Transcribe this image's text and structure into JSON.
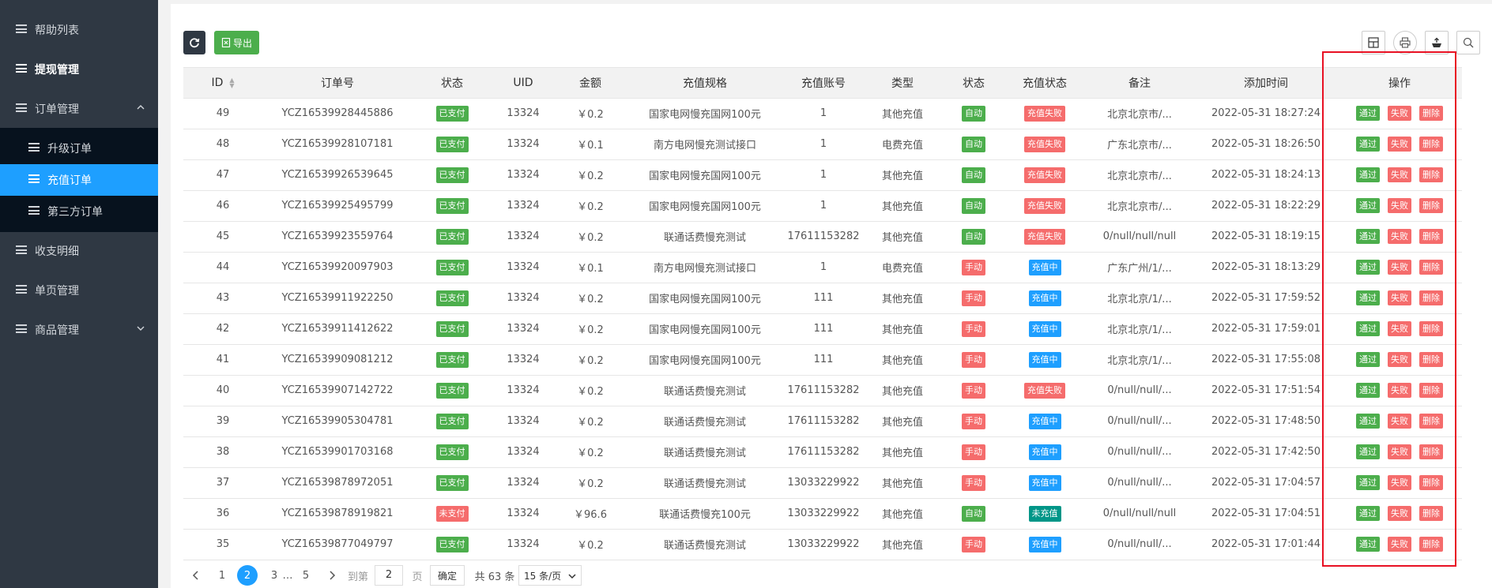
{
  "sidebar": {
    "items": [
      {
        "label": "帮助列表",
        "icon": "list-icon"
      },
      {
        "label": "提现管理",
        "icon": "list-icon"
      },
      {
        "label": "订单管理",
        "icon": "list-icon"
      },
      {
        "label": "收支明细",
        "icon": "list-icon"
      },
      {
        "label": "单页管理",
        "icon": "list-icon"
      },
      {
        "label": "商品管理",
        "icon": "list-icon"
      }
    ],
    "sub_items": [
      {
        "label": "升级订单"
      },
      {
        "label": "充值订单"
      },
      {
        "label": "第三方订单"
      }
    ]
  },
  "toolbar": {
    "refresh_icon": "refresh-icon",
    "export_label": "导出",
    "tools": [
      "columns-icon",
      "print-icon",
      "export-icon",
      "search-icon"
    ]
  },
  "table": {
    "headers": [
      "ID",
      "订单号",
      "状态",
      "UID",
      "金额",
      "充值规格",
      "充值账号",
      "类型",
      "状态",
      "充值状态",
      "备注",
      "添加时间",
      "操作"
    ],
    "action_labels": {
      "pass": "通过",
      "fail": "失败",
      "delete": "删除"
    },
    "rows": [
      {
        "id": "49",
        "order": "YCZ16539928445886",
        "pay": "已支付",
        "uid": "13324",
        "amount": "￥0.2",
        "spec": "国家电网慢充国网100元",
        "account": "1",
        "type": "其他充值",
        "mode": "自动",
        "charge": "充值失败",
        "note": "北京北京市/...",
        "time": "2022-05-31 18:27:24"
      },
      {
        "id": "48",
        "order": "YCZ16539928107181",
        "pay": "已支付",
        "uid": "13324",
        "amount": "￥0.1",
        "spec": "南方电网慢充测试接口",
        "account": "1",
        "type": "电费充值",
        "mode": "自动",
        "charge": "充值失败",
        "note": "广东北京市/...",
        "time": "2022-05-31 18:26:50"
      },
      {
        "id": "47",
        "order": "YCZ16539926539645",
        "pay": "已支付",
        "uid": "13324",
        "amount": "￥0.2",
        "spec": "国家电网慢充国网100元",
        "account": "1",
        "type": "其他充值",
        "mode": "自动",
        "charge": "充值失败",
        "note": "北京北京市/...",
        "time": "2022-05-31 18:24:13"
      },
      {
        "id": "46",
        "order": "YCZ16539925495799",
        "pay": "已支付",
        "uid": "13324",
        "amount": "￥0.2",
        "spec": "国家电网慢充国网100元",
        "account": "1",
        "type": "其他充值",
        "mode": "自动",
        "charge": "充值失败",
        "note": "北京北京市/...",
        "time": "2022-05-31 18:22:29"
      },
      {
        "id": "45",
        "order": "YCZ16539923559764",
        "pay": "已支付",
        "uid": "13324",
        "amount": "￥0.2",
        "spec": "联通话费慢充测试",
        "account": "17611153282",
        "type": "其他充值",
        "mode": "自动",
        "charge": "充值失败",
        "note": "0/null/null/null",
        "time": "2022-05-31 18:19:15"
      },
      {
        "id": "44",
        "order": "YCZ16539920097903",
        "pay": "已支付",
        "uid": "13324",
        "amount": "￥0.1",
        "spec": "南方电网慢充测试接口",
        "account": "1",
        "type": "电费充值",
        "mode": "手动",
        "charge": "充值中",
        "note": "广东广州/1/...",
        "time": "2022-05-31 18:13:29"
      },
      {
        "id": "43",
        "order": "YCZ16539911922250",
        "pay": "已支付",
        "uid": "13324",
        "amount": "￥0.2",
        "spec": "国家电网慢充国网100元",
        "account": "111",
        "type": "其他充值",
        "mode": "手动",
        "charge": "充值中",
        "note": "北京北京/1/...",
        "time": "2022-05-31 17:59:52"
      },
      {
        "id": "42",
        "order": "YCZ16539911412622",
        "pay": "已支付",
        "uid": "13324",
        "amount": "￥0.2",
        "spec": "国家电网慢充国网100元",
        "account": "111",
        "type": "其他充值",
        "mode": "手动",
        "charge": "充值中",
        "note": "北京北京/1/...",
        "time": "2022-05-31 17:59:01"
      },
      {
        "id": "41",
        "order": "YCZ16539909081212",
        "pay": "已支付",
        "uid": "13324",
        "amount": "￥0.2",
        "spec": "国家电网慢充国网100元",
        "account": "111",
        "type": "其他充值",
        "mode": "手动",
        "charge": "充值中",
        "note": "北京北京/1/...",
        "time": "2022-05-31 17:55:08"
      },
      {
        "id": "40",
        "order": "YCZ16539907142722",
        "pay": "已支付",
        "uid": "13324",
        "amount": "￥0.2",
        "spec": "联通话费慢充测试",
        "account": "17611153282",
        "type": "其他充值",
        "mode": "手动",
        "charge": "充值失败",
        "note": "0/null/null/...",
        "time": "2022-05-31 17:51:54"
      },
      {
        "id": "39",
        "order": "YCZ16539905304781",
        "pay": "已支付",
        "uid": "13324",
        "amount": "￥0.2",
        "spec": "联通话费慢充测试",
        "account": "17611153282",
        "type": "其他充值",
        "mode": "手动",
        "charge": "充值中",
        "note": "0/null/null/...",
        "time": "2022-05-31 17:48:50"
      },
      {
        "id": "38",
        "order": "YCZ16539901703168",
        "pay": "已支付",
        "uid": "13324",
        "amount": "￥0.2",
        "spec": "联通话费慢充测试",
        "account": "17611153282",
        "type": "其他充值",
        "mode": "手动",
        "charge": "充值中",
        "note": "0/null/null/...",
        "time": "2022-05-31 17:42:50"
      },
      {
        "id": "37",
        "order": "YCZ16539878972051",
        "pay": "已支付",
        "uid": "13324",
        "amount": "￥0.2",
        "spec": "联通话费慢充测试",
        "account": "13033229922",
        "type": "其他充值",
        "mode": "手动",
        "charge": "充值中",
        "note": "0/null/null/...",
        "time": "2022-05-31 17:04:57"
      },
      {
        "id": "36",
        "order": "YCZ16539878919821",
        "pay": "未支付",
        "uid": "13324",
        "amount": "￥96.6",
        "spec": "联通话费慢充100元",
        "account": "13033229922",
        "type": "其他充值",
        "mode": "自动",
        "charge": "未充值",
        "note": "0/null/null/null",
        "time": "2022-05-31 17:04:51"
      },
      {
        "id": "35",
        "order": "YCZ16539877049797",
        "pay": "已支付",
        "uid": "13324",
        "amount": "￥0.2",
        "spec": "联通话费慢充测试",
        "account": "13033229922",
        "type": "其他充值",
        "mode": "手动",
        "charge": "充值中",
        "note": "0/null/null/...",
        "time": "2022-05-31 17:01:44"
      }
    ]
  },
  "pagination": {
    "pages": [
      "1",
      "2",
      "3",
      "…",
      "5"
    ],
    "current": "2",
    "goto_label": "到第",
    "goto_value": "2",
    "page_unit": "页",
    "confirm_label": "确定",
    "total_label": "共 63 条",
    "page_size": "15 条/页"
  },
  "colors": {
    "sidebar_bg": "#2f3843",
    "active_blue": "#1e9fff",
    "success_green": "#4cae4c",
    "danger_red": "#f56c6c",
    "teal": "#009688",
    "highlight_box": "#e81123"
  }
}
